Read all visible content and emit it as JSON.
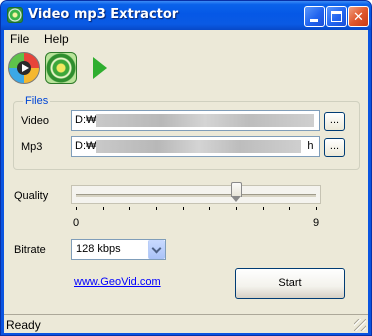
{
  "window": {
    "title": "Video mp3 Extractor"
  },
  "titlebar_buttons": [
    "minimize-icon",
    "maximize-icon",
    "close-icon"
  ],
  "menu": {
    "file": "File",
    "help": "Help"
  },
  "toolbar": {
    "icons": [
      "disc-play-icon",
      "app-logo-icon",
      "play-icon"
    ]
  },
  "files": {
    "group_label": "Files",
    "video_label": "Video",
    "video_path": "D:₩",
    "mp3_label": "Mp3",
    "mp3_path": "D:₩",
    "mp3_path_tail": "h",
    "browse_label": "..."
  },
  "quality": {
    "label": "Quality",
    "min": "0",
    "max": "9",
    "value": 6
  },
  "bitrate": {
    "label": "Bitrate",
    "selected": "128 kbps"
  },
  "link": {
    "text": "www.GeoVid.com"
  },
  "start_label": "Start",
  "status": {
    "text": "Ready"
  },
  "colors": {
    "title_blue": "#0a54e0",
    "group_label": "#0046d5",
    "link": "#0000ff",
    "face": "#ece9d8"
  }
}
